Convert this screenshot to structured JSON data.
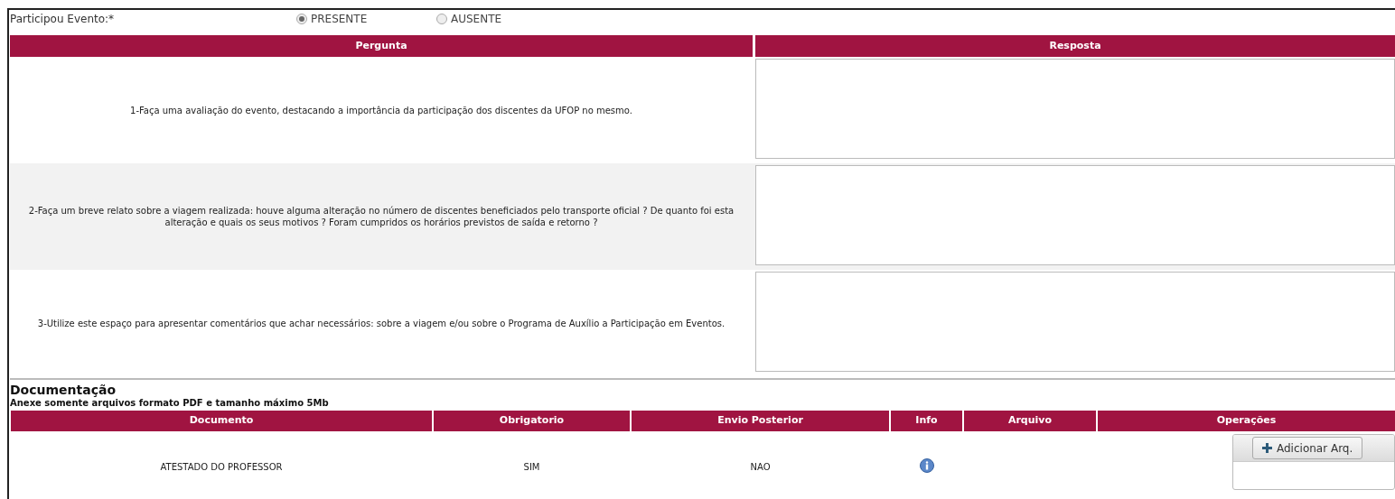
{
  "participation": {
    "label": "Participou Evento:*",
    "options": [
      {
        "label": "PRESENTE",
        "selected": true
      },
      {
        "label": "AUSENTE",
        "selected": false
      }
    ]
  },
  "questions": {
    "columns": [
      "Pergunta",
      "Resposta"
    ],
    "rows": [
      {
        "question": "1-Faça uma avaliação do evento, destacando a importância da participação dos discentes da UFOP no mesmo."
      },
      {
        "question": "2-Faça um breve relato sobre a viagem realizada: houve alguma alteração no número de discentes beneficiados pelo transporte oficial ? De quanto foi esta alteração e quais os seus motivos ? Foram cumpridos os horários previstos de saída e retorno ?"
      },
      {
        "question": "3-Utilize este espaço para apresentar comentários que achar necessários: sobre a viagem e/ou sobre o Programa de Auxílio a Participação em Eventos."
      }
    ]
  },
  "documentation": {
    "title": "Documentação",
    "note": "Anexe somente arquivos formato PDF e tamanho máximo 5Mb",
    "columns": [
      "Documento",
      "Obrigatorio",
      "Envio Posterior",
      "Info",
      "Arquivo",
      "Operações"
    ],
    "rows": [
      {
        "document": "ATESTADO DO PROFESSOR",
        "required": "SIM",
        "later": "NAO",
        "button": "Adicionar Arq."
      }
    ]
  }
}
